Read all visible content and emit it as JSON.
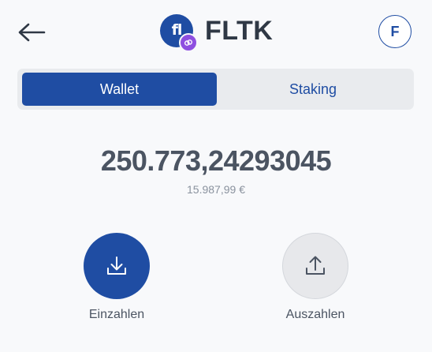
{
  "header": {
    "back_icon": "arrow-left-icon",
    "token_logo_text": "fl",
    "chain_badge_icon": "polygon-chain-icon",
    "token_symbol": "FLTK",
    "profile_initial": "F"
  },
  "tabs": [
    {
      "label": "Wallet",
      "active": true
    },
    {
      "label": "Staking",
      "active": false
    }
  ],
  "balance": {
    "amount": "250.773,24293045",
    "fiat": "15.987,99 €"
  },
  "actions": {
    "deposit": {
      "label": "Einzahlen",
      "icon": "download-icon"
    },
    "withdraw": {
      "label": "Auszahlen",
      "icon": "upload-icon"
    }
  },
  "colors": {
    "primary": "#1f4da3",
    "badge": "#8e4fe0",
    "background": "#f8f9fb"
  }
}
